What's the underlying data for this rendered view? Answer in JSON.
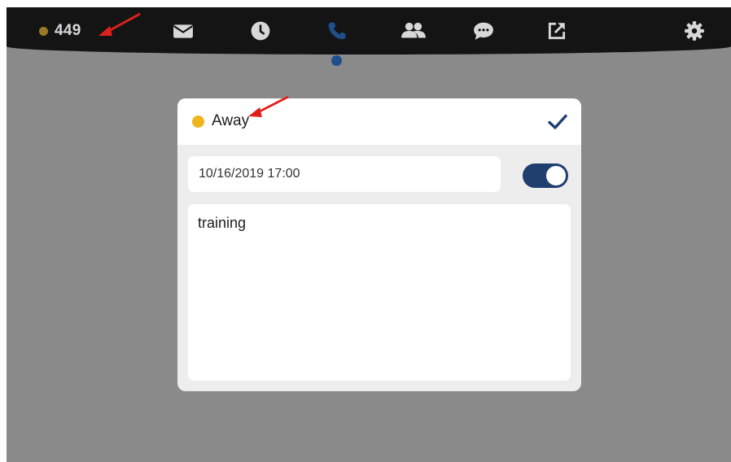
{
  "topbar": {
    "status": {
      "count": "449",
      "dot_color": "#9a7a28"
    },
    "nav": [
      {
        "icon": "envelope-icon",
        "active": false
      },
      {
        "icon": "clock-icon",
        "active": false
      },
      {
        "icon": "phone-icon",
        "active": true
      },
      {
        "icon": "contacts-icon",
        "active": false
      },
      {
        "icon": "chat-icon",
        "active": false
      },
      {
        "icon": "external-link-icon",
        "active": false
      }
    ],
    "settings_icon": "gear-icon",
    "icon_color": "#d8d8d8",
    "active_color": "#1e4f8c"
  },
  "dialog": {
    "status_label": "Away",
    "status_color": "#f0b41e",
    "confirm_icon": "checkmark-icon",
    "datetime_value": "10/16/2019 17:00",
    "toggle_on": true,
    "message_value": "training"
  },
  "annotations": {
    "arrow_color": "#e0211b"
  }
}
